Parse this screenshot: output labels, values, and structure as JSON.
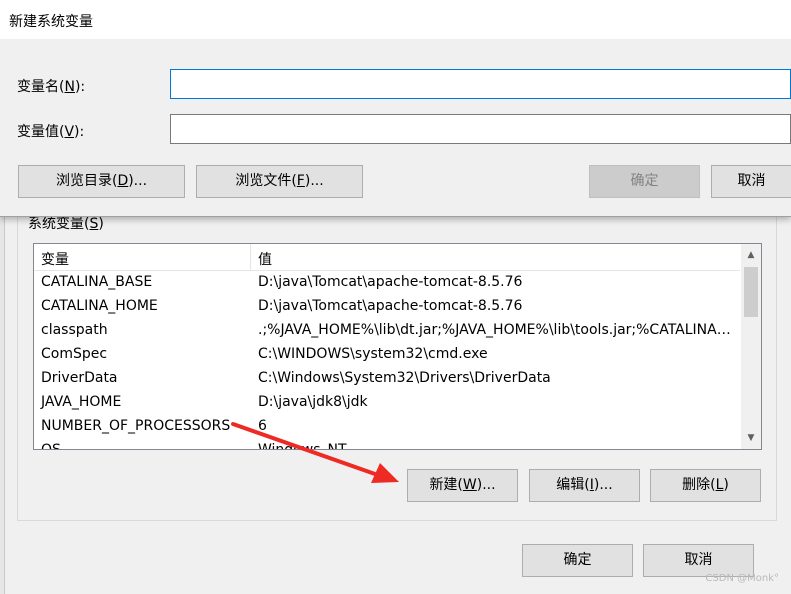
{
  "dialog": {
    "title": "新建系统变量",
    "name_label": {
      "pre": "变量名(",
      "key": "N",
      "post": "):"
    },
    "value_label": {
      "pre": "变量值(",
      "key": "V",
      "post": "):"
    },
    "name_value": "",
    "value_value": "",
    "browse_dir": {
      "pre": "浏览目录(",
      "key": "D",
      "post": ")..."
    },
    "browse_file": {
      "pre": "浏览文件(",
      "key": "F",
      "post": ")..."
    },
    "ok": "确定",
    "cancel": "取消"
  },
  "background": {
    "group_label": {
      "pre": "系统变量(",
      "key": "S",
      "post": ")"
    },
    "columns": [
      "变量",
      "值"
    ],
    "rows": [
      {
        "name": "CATALINA_BASE",
        "value": "D:\\java\\Tomcat\\apache-tomcat-8.5.76"
      },
      {
        "name": "CATALINA_HOME",
        "value": "D:\\java\\Tomcat\\apache-tomcat-8.5.76"
      },
      {
        "name": "classpath",
        "value": ".;%JAVA_HOME%\\lib\\dt.jar;%JAVA_HOME%\\lib\\tools.jar;%CATALINA_HOME%\\lib\\servlet-api.jar"
      },
      {
        "name": "ComSpec",
        "value": "C:\\WINDOWS\\system32\\cmd.exe"
      },
      {
        "name": "DriverData",
        "value": "C:\\Windows\\System32\\Drivers\\DriverData"
      },
      {
        "name": "JAVA_HOME",
        "value": "D:\\java\\jdk8\\jdk"
      },
      {
        "name": "NUMBER_OF_PROCESSORS",
        "value": "6"
      },
      {
        "name": "OS",
        "value": "Windows_NT"
      }
    ],
    "new_btn": {
      "pre": "新建(",
      "key": "W",
      "post": ")..."
    },
    "edit_btn": {
      "pre": "编辑(",
      "key": "I",
      "post": ")..."
    },
    "delete_btn": {
      "pre": "删除(",
      "key": "L",
      "post": ")"
    },
    "ok": "确定",
    "cancel": "取消"
  },
  "annotation": {
    "color": "#ee2a24"
  },
  "watermark": "CSDN @Monk°"
}
